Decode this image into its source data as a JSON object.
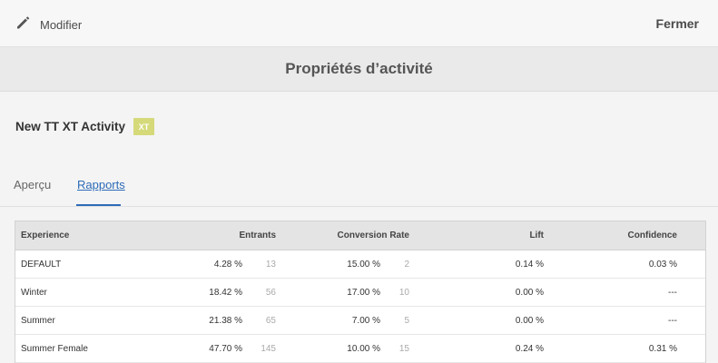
{
  "header": {
    "edit_label": "Modifier",
    "close_label": "Fermer"
  },
  "page_title": "Propriétés d’activité",
  "activity": {
    "name": "New TT XT Activity",
    "badge": "XT",
    "badge_color": "#d5d97a"
  },
  "tabs": [
    {
      "label": "Aperçu",
      "active": false
    },
    {
      "label": "Rapports",
      "active": true
    }
  ],
  "accent_color": "#2d6bb8",
  "table": {
    "columns": {
      "experience": "Experience",
      "entrants": "Entrants",
      "conversion_rate": "Conversion Rate",
      "lift": "Lift",
      "confidence": "Confidence"
    },
    "rows": [
      {
        "experience": "DEFAULT",
        "entrants_pct": "4.28 %",
        "entrants_count": "13",
        "conversion_pct": "15.00 %",
        "conversion_count": "2",
        "lift": "0.14 %",
        "confidence": "0.03 %"
      },
      {
        "experience": "Winter",
        "entrants_pct": "18.42 %",
        "entrants_count": "56",
        "conversion_pct": "17.00 %",
        "conversion_count": "10",
        "lift": "0.00 %",
        "confidence": "---"
      },
      {
        "experience": "Summer",
        "entrants_pct": "21.38 %",
        "entrants_count": "65",
        "conversion_pct": "7.00 %",
        "conversion_count": "5",
        "lift": "0.00 %",
        "confidence": "---"
      },
      {
        "experience": "Summer Female",
        "entrants_pct": "47.70 %",
        "entrants_count": "145",
        "conversion_pct": "10.00 %",
        "conversion_count": "15",
        "lift": "0.24 %",
        "confidence": "0.31 %"
      }
    ]
  }
}
